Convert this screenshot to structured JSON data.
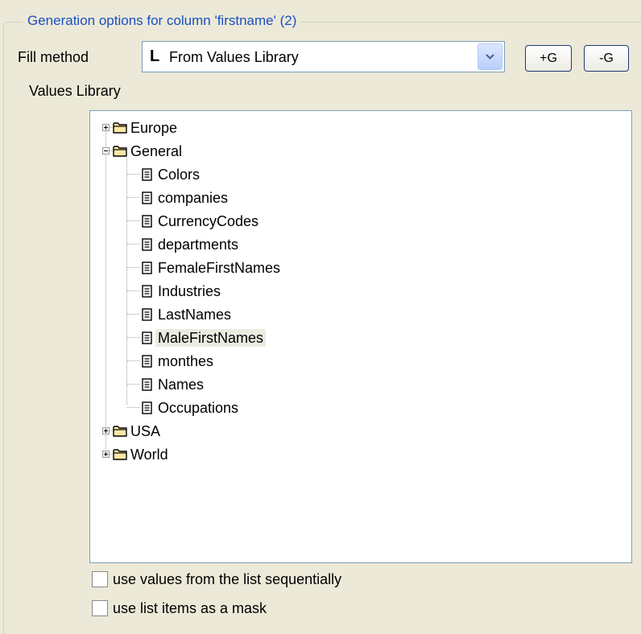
{
  "group": {
    "title": "Generation options for column 'firstname' (2)"
  },
  "fill_method": {
    "label": "Fill method",
    "selected_mark": "L",
    "selected_value": "From Values Library",
    "add_button": "+G",
    "remove_button": "-G"
  },
  "values_library": {
    "label": "Values Library",
    "folders": [
      {
        "name": "Europe",
        "expanded": false
      },
      {
        "name": "General",
        "expanded": true,
        "items": [
          "Colors",
          "companies",
          "CurrencyCodes",
          "departments",
          "FemaleFirstNames",
          "Industries",
          "LastNames",
          "MaleFirstNames",
          "monthes",
          "Names",
          "Occupations"
        ],
        "selected": "MaleFirstNames"
      },
      {
        "name": "USA",
        "expanded": false
      },
      {
        "name": "World",
        "expanded": false
      }
    ]
  },
  "options": {
    "sequential_label": "use values from the list sequentially",
    "sequential_checked": false,
    "mask_label": "use list items as a mask",
    "mask_checked": false
  },
  "icons": {
    "folder": "folder-icon",
    "document": "document-icon",
    "expand": "expander-icon",
    "dropdown": "chevron-down-icon"
  }
}
